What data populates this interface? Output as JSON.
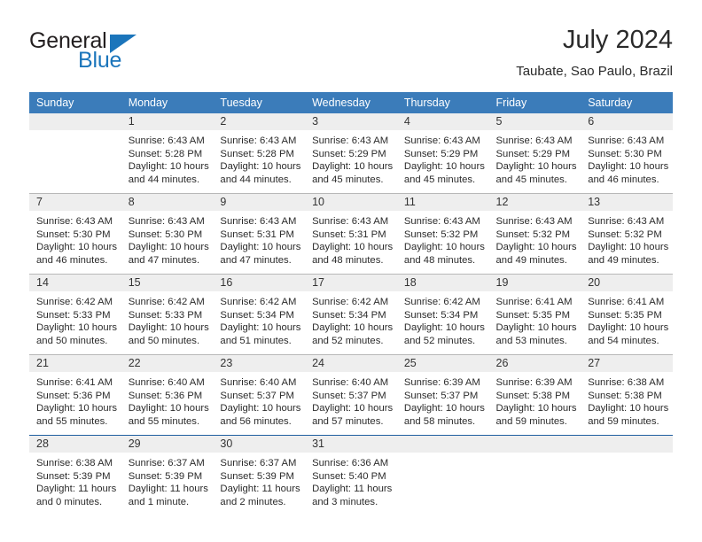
{
  "brand": {
    "name_top": "General",
    "name_bottom": "Blue",
    "triangle_color": "#1b75bb",
    "text_color": "#231f20"
  },
  "header": {
    "month_title": "July 2024",
    "location": "Taubate, Sao Paulo, Brazil"
  },
  "theme": {
    "header_row_bg": "#3b7cba",
    "header_row_text": "#ffffff",
    "daynum_bg": "#eeeeee",
    "row_divider": "#b8b8b8",
    "last_row_divider": "#1f5fa0"
  },
  "weekday_headers": [
    "Sunday",
    "Monday",
    "Tuesday",
    "Wednesday",
    "Thursday",
    "Friday",
    "Saturday"
  ],
  "weeks": [
    [
      {
        "day": "",
        "empty": true,
        "sunrise": "",
        "sunset": "",
        "daylight_line1": "",
        "daylight_line2": ""
      },
      {
        "day": "1",
        "sunrise": "Sunrise: 6:43 AM",
        "sunset": "Sunset: 5:28 PM",
        "daylight_line1": "Daylight: 10 hours",
        "daylight_line2": "and 44 minutes."
      },
      {
        "day": "2",
        "sunrise": "Sunrise: 6:43 AM",
        "sunset": "Sunset: 5:28 PM",
        "daylight_line1": "Daylight: 10 hours",
        "daylight_line2": "and 44 minutes."
      },
      {
        "day": "3",
        "sunrise": "Sunrise: 6:43 AM",
        "sunset": "Sunset: 5:29 PM",
        "daylight_line1": "Daylight: 10 hours",
        "daylight_line2": "and 45 minutes."
      },
      {
        "day": "4",
        "sunrise": "Sunrise: 6:43 AM",
        "sunset": "Sunset: 5:29 PM",
        "daylight_line1": "Daylight: 10 hours",
        "daylight_line2": "and 45 minutes."
      },
      {
        "day": "5",
        "sunrise": "Sunrise: 6:43 AM",
        "sunset": "Sunset: 5:29 PM",
        "daylight_line1": "Daylight: 10 hours",
        "daylight_line2": "and 45 minutes."
      },
      {
        "day": "6",
        "sunrise": "Sunrise: 6:43 AM",
        "sunset": "Sunset: 5:30 PM",
        "daylight_line1": "Daylight: 10 hours",
        "daylight_line2": "and 46 minutes."
      }
    ],
    [
      {
        "day": "7",
        "sunrise": "Sunrise: 6:43 AM",
        "sunset": "Sunset: 5:30 PM",
        "daylight_line1": "Daylight: 10 hours",
        "daylight_line2": "and 46 minutes."
      },
      {
        "day": "8",
        "sunrise": "Sunrise: 6:43 AM",
        "sunset": "Sunset: 5:30 PM",
        "daylight_line1": "Daylight: 10 hours",
        "daylight_line2": "and 47 minutes."
      },
      {
        "day": "9",
        "sunrise": "Sunrise: 6:43 AM",
        "sunset": "Sunset: 5:31 PM",
        "daylight_line1": "Daylight: 10 hours",
        "daylight_line2": "and 47 minutes."
      },
      {
        "day": "10",
        "sunrise": "Sunrise: 6:43 AM",
        "sunset": "Sunset: 5:31 PM",
        "daylight_line1": "Daylight: 10 hours",
        "daylight_line2": "and 48 minutes."
      },
      {
        "day": "11",
        "sunrise": "Sunrise: 6:43 AM",
        "sunset": "Sunset: 5:32 PM",
        "daylight_line1": "Daylight: 10 hours",
        "daylight_line2": "and 48 minutes."
      },
      {
        "day": "12",
        "sunrise": "Sunrise: 6:43 AM",
        "sunset": "Sunset: 5:32 PM",
        "daylight_line1": "Daylight: 10 hours",
        "daylight_line2": "and 49 minutes."
      },
      {
        "day": "13",
        "sunrise": "Sunrise: 6:43 AM",
        "sunset": "Sunset: 5:32 PM",
        "daylight_line1": "Daylight: 10 hours",
        "daylight_line2": "and 49 minutes."
      }
    ],
    [
      {
        "day": "14",
        "sunrise": "Sunrise: 6:42 AM",
        "sunset": "Sunset: 5:33 PM",
        "daylight_line1": "Daylight: 10 hours",
        "daylight_line2": "and 50 minutes."
      },
      {
        "day": "15",
        "sunrise": "Sunrise: 6:42 AM",
        "sunset": "Sunset: 5:33 PM",
        "daylight_line1": "Daylight: 10 hours",
        "daylight_line2": "and 50 minutes."
      },
      {
        "day": "16",
        "sunrise": "Sunrise: 6:42 AM",
        "sunset": "Sunset: 5:34 PM",
        "daylight_line1": "Daylight: 10 hours",
        "daylight_line2": "and 51 minutes."
      },
      {
        "day": "17",
        "sunrise": "Sunrise: 6:42 AM",
        "sunset": "Sunset: 5:34 PM",
        "daylight_line1": "Daylight: 10 hours",
        "daylight_line2": "and 52 minutes."
      },
      {
        "day": "18",
        "sunrise": "Sunrise: 6:42 AM",
        "sunset": "Sunset: 5:34 PM",
        "daylight_line1": "Daylight: 10 hours",
        "daylight_line2": "and 52 minutes."
      },
      {
        "day": "19",
        "sunrise": "Sunrise: 6:41 AM",
        "sunset": "Sunset: 5:35 PM",
        "daylight_line1": "Daylight: 10 hours",
        "daylight_line2": "and 53 minutes."
      },
      {
        "day": "20",
        "sunrise": "Sunrise: 6:41 AM",
        "sunset": "Sunset: 5:35 PM",
        "daylight_line1": "Daylight: 10 hours",
        "daylight_line2": "and 54 minutes."
      }
    ],
    [
      {
        "day": "21",
        "sunrise": "Sunrise: 6:41 AM",
        "sunset": "Sunset: 5:36 PM",
        "daylight_line1": "Daylight: 10 hours",
        "daylight_line2": "and 55 minutes."
      },
      {
        "day": "22",
        "sunrise": "Sunrise: 6:40 AM",
        "sunset": "Sunset: 5:36 PM",
        "daylight_line1": "Daylight: 10 hours",
        "daylight_line2": "and 55 minutes."
      },
      {
        "day": "23",
        "sunrise": "Sunrise: 6:40 AM",
        "sunset": "Sunset: 5:37 PM",
        "daylight_line1": "Daylight: 10 hours",
        "daylight_line2": "and 56 minutes."
      },
      {
        "day": "24",
        "sunrise": "Sunrise: 6:40 AM",
        "sunset": "Sunset: 5:37 PM",
        "daylight_line1": "Daylight: 10 hours",
        "daylight_line2": "and 57 minutes."
      },
      {
        "day": "25",
        "sunrise": "Sunrise: 6:39 AM",
        "sunset": "Sunset: 5:37 PM",
        "daylight_line1": "Daylight: 10 hours",
        "daylight_line2": "and 58 minutes."
      },
      {
        "day": "26",
        "sunrise": "Sunrise: 6:39 AM",
        "sunset": "Sunset: 5:38 PM",
        "daylight_line1": "Daylight: 10 hours",
        "daylight_line2": "and 59 minutes."
      },
      {
        "day": "27",
        "sunrise": "Sunrise: 6:38 AM",
        "sunset": "Sunset: 5:38 PM",
        "daylight_line1": "Daylight: 10 hours",
        "daylight_line2": "and 59 minutes."
      }
    ],
    [
      {
        "day": "28",
        "sunrise": "Sunrise: 6:38 AM",
        "sunset": "Sunset: 5:39 PM",
        "daylight_line1": "Daylight: 11 hours",
        "daylight_line2": "and 0 minutes."
      },
      {
        "day": "29",
        "sunrise": "Sunrise: 6:37 AM",
        "sunset": "Sunset: 5:39 PM",
        "daylight_line1": "Daylight: 11 hours",
        "daylight_line2": "and 1 minute."
      },
      {
        "day": "30",
        "sunrise": "Sunrise: 6:37 AM",
        "sunset": "Sunset: 5:39 PM",
        "daylight_line1": "Daylight: 11 hours",
        "daylight_line2": "and 2 minutes."
      },
      {
        "day": "31",
        "sunrise": "Sunrise: 6:36 AM",
        "sunset": "Sunset: 5:40 PM",
        "daylight_line1": "Daylight: 11 hours",
        "daylight_line2": "and 3 minutes."
      },
      {
        "day": "",
        "empty": true,
        "sunrise": "",
        "sunset": "",
        "daylight_line1": "",
        "daylight_line2": ""
      },
      {
        "day": "",
        "empty": true,
        "sunrise": "",
        "sunset": "",
        "daylight_line1": "",
        "daylight_line2": ""
      },
      {
        "day": "",
        "empty": true,
        "sunrise": "",
        "sunset": "",
        "daylight_line1": "",
        "daylight_line2": ""
      }
    ]
  ]
}
